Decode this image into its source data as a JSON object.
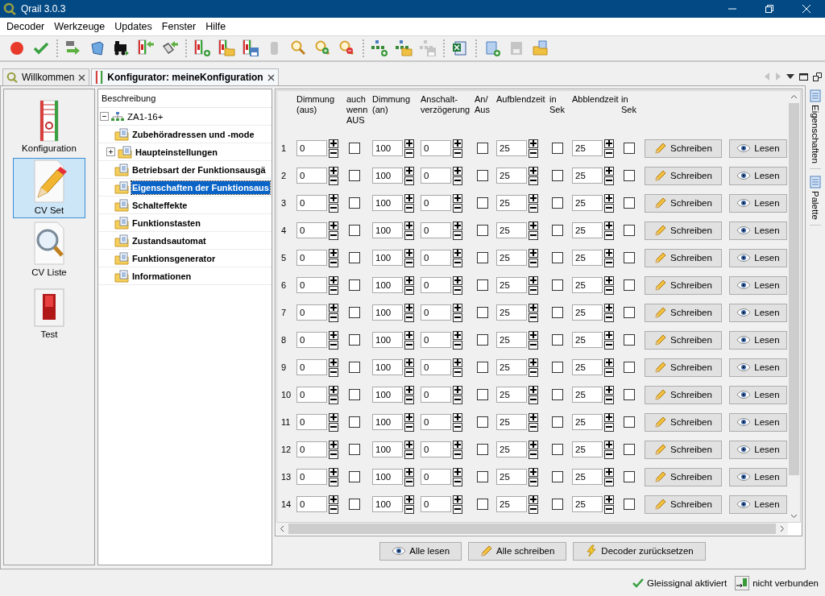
{
  "window": {
    "title": "Qrail 3.0.3"
  },
  "menu": [
    "Decoder",
    "Werkzeuge",
    "Updates",
    "Fenster",
    "Hilfe"
  ],
  "toolbar": [
    {
      "disabled": false
    },
    {
      "disabled": false
    },
    {
      "disabled": false
    },
    {
      "disabled": false
    },
    {
      "disabled": false
    },
    {
      "disabled": false
    },
    {
      "disabled": false
    },
    {
      "disabled": false
    },
    {
      "disabled": false
    },
    {
      "disabled": false
    },
    {
      "disabled": true
    },
    {
      "disabled": false
    },
    {
      "disabled": false
    },
    {
      "disabled": false
    },
    {
      "disabled": false
    },
    {
      "disabled": false
    },
    {
      "disabled": true
    },
    {
      "disabled": false
    },
    {
      "disabled": false
    },
    {
      "disabled": true
    },
    {
      "disabled": false
    }
  ],
  "tabs": [
    {
      "label": "Willkommen",
      "selected": false
    },
    {
      "label": "Konfigurator: meineKonfiguration",
      "selected": true
    }
  ],
  "nav": [
    {
      "label": "Konfiguration",
      "selected": false
    },
    {
      "label": "CV Set",
      "selected": true
    },
    {
      "label": "CV Liste",
      "selected": false
    },
    {
      "label": "Test",
      "selected": false
    }
  ],
  "tree": {
    "header": "Beschreibung",
    "root": {
      "label": "ZA1-16+",
      "expanded": true,
      "children": [
        {
          "label": "Zubehöradressen und -mode",
          "kind": "leaf",
          "selected": false
        },
        {
          "label": "Haupteinstellungen",
          "kind": "group",
          "expanded": false,
          "selected": false
        },
        {
          "label": "Betriebsart der Funktionsausgä",
          "kind": "leaf",
          "selected": false
        },
        {
          "label": "Eigenschaften der Funktionsaus",
          "kind": "leaf",
          "selected": true
        },
        {
          "label": "Schalteffekte",
          "kind": "leaf",
          "selected": false
        },
        {
          "label": "Funktionstasten",
          "kind": "leaf",
          "selected": false
        },
        {
          "label": "Zustandsautomat",
          "kind": "leaf",
          "selected": false
        },
        {
          "label": "Funktionsgenerator",
          "kind": "leaf",
          "selected": false
        },
        {
          "label": "Informationen",
          "kind": "leaf",
          "selected": false
        }
      ]
    }
  },
  "table": {
    "columns": [
      "Dimmung (aus)",
      "auch wenn AUS",
      "Dimmung (an)",
      "Anschalt-verzögerung",
      "An/ Aus",
      "Aufblendzeit",
      "in Sek",
      "Abblendzeit",
      "in Sek"
    ],
    "rows": [
      {
        "number": "1",
        "dim_off": "0",
        "also_off": false,
        "dim_on": "100",
        "delay": "0",
        "on_off": false,
        "fade_in": "25",
        "fade_in_sec": false,
        "fade_out": "25",
        "fade_out_sec": false,
        "write": "Schreiben",
        "read": "Lesen"
      },
      {
        "number": "2",
        "dim_off": "0",
        "also_off": false,
        "dim_on": "100",
        "delay": "0",
        "on_off": false,
        "fade_in": "25",
        "fade_in_sec": false,
        "fade_out": "25",
        "fade_out_sec": false,
        "write": "Schreiben",
        "read": "Lesen"
      },
      {
        "number": "3",
        "dim_off": "0",
        "also_off": false,
        "dim_on": "100",
        "delay": "0",
        "on_off": false,
        "fade_in": "25",
        "fade_in_sec": false,
        "fade_out": "25",
        "fade_out_sec": false,
        "write": "Schreiben",
        "read": "Lesen"
      },
      {
        "number": "4",
        "dim_off": "0",
        "also_off": false,
        "dim_on": "100",
        "delay": "0",
        "on_off": false,
        "fade_in": "25",
        "fade_in_sec": false,
        "fade_out": "25",
        "fade_out_sec": false,
        "write": "Schreiben",
        "read": "Lesen"
      },
      {
        "number": "5",
        "dim_off": "0",
        "also_off": false,
        "dim_on": "100",
        "delay": "0",
        "on_off": false,
        "fade_in": "25",
        "fade_in_sec": false,
        "fade_out": "25",
        "fade_out_sec": false,
        "write": "Schreiben",
        "read": "Lesen"
      },
      {
        "number": "6",
        "dim_off": "0",
        "also_off": false,
        "dim_on": "100",
        "delay": "0",
        "on_off": false,
        "fade_in": "25",
        "fade_in_sec": false,
        "fade_out": "25",
        "fade_out_sec": false,
        "write": "Schreiben",
        "read": "Lesen"
      },
      {
        "number": "7",
        "dim_off": "0",
        "also_off": false,
        "dim_on": "100",
        "delay": "0",
        "on_off": false,
        "fade_in": "25",
        "fade_in_sec": false,
        "fade_out": "25",
        "fade_out_sec": false,
        "write": "Schreiben",
        "read": "Lesen"
      },
      {
        "number": "8",
        "dim_off": "0",
        "also_off": false,
        "dim_on": "100",
        "delay": "0",
        "on_off": false,
        "fade_in": "25",
        "fade_in_sec": false,
        "fade_out": "25",
        "fade_out_sec": false,
        "write": "Schreiben",
        "read": "Lesen"
      },
      {
        "number": "9",
        "dim_off": "0",
        "also_off": false,
        "dim_on": "100",
        "delay": "0",
        "on_off": false,
        "fade_in": "25",
        "fade_in_sec": false,
        "fade_out": "25",
        "fade_out_sec": false,
        "write": "Schreiben",
        "read": "Lesen"
      },
      {
        "number": "10",
        "dim_off": "0",
        "also_off": false,
        "dim_on": "100",
        "delay": "0",
        "on_off": false,
        "fade_in": "25",
        "fade_in_sec": false,
        "fade_out": "25",
        "fade_out_sec": false,
        "write": "Schreiben",
        "read": "Lesen"
      },
      {
        "number": "11",
        "dim_off": "0",
        "also_off": false,
        "dim_on": "100",
        "delay": "0",
        "on_off": false,
        "fade_in": "25",
        "fade_in_sec": false,
        "fade_out": "25",
        "fade_out_sec": false,
        "write": "Schreiben",
        "read": "Lesen"
      },
      {
        "number": "12",
        "dim_off": "0",
        "also_off": false,
        "dim_on": "100",
        "delay": "0",
        "on_off": false,
        "fade_in": "25",
        "fade_in_sec": false,
        "fade_out": "25",
        "fade_out_sec": false,
        "write": "Schreiben",
        "read": "Lesen"
      },
      {
        "number": "13",
        "dim_off": "0",
        "also_off": false,
        "dim_on": "100",
        "delay": "0",
        "on_off": false,
        "fade_in": "25",
        "fade_in_sec": false,
        "fade_out": "25",
        "fade_out_sec": false,
        "write": "Schreiben",
        "read": "Lesen"
      },
      {
        "number": "14",
        "dim_off": "0",
        "also_off": false,
        "dim_on": "100",
        "delay": "0",
        "on_off": false,
        "fade_in": "25",
        "fade_in_sec": false,
        "fade_out": "25",
        "fade_out_sec": false,
        "write": "Schreiben",
        "read": "Lesen"
      }
    ]
  },
  "actions": [
    {
      "label": "Alle lesen",
      "kind": "read"
    },
    {
      "label": "Alle schreiben",
      "kind": "write"
    },
    {
      "label": "Decoder zurücksetzen",
      "kind": "reset"
    }
  ],
  "side_dock": [
    "Eigenschaften",
    "Palette"
  ],
  "status": [
    {
      "kind": "signal",
      "text": "Gleissignal aktiviert"
    },
    {
      "kind": "connection",
      "text": "nicht verbunden"
    }
  ]
}
